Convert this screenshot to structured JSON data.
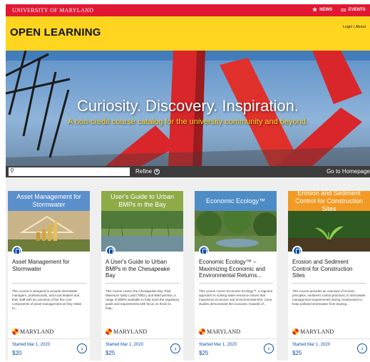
{
  "topbar": {
    "university": "UNIVERSITY OF MARYLAND",
    "news_label": "NEWS",
    "events_label": "EVENTS",
    "star_icon": "star-icon",
    "calendar_icon": "calendar-icon",
    "color": "#e21833"
  },
  "header": {
    "title": "OPEN LEARNING",
    "login": "Login",
    "separator": "|",
    "about": "About",
    "color": "#ffd520"
  },
  "hero": {
    "title": "Curiosity. Discovery. Inspiration.",
    "subtitle": "A non-credit course catalog for the university community and beyond."
  },
  "search": {
    "placeholder": "",
    "refine_label": "Refine",
    "homepage_label": "Go to Homepage"
  },
  "cards": [
    {
      "header": "Asset Management for Stormwater",
      "header_color": "#5b8fcb",
      "title": "Asset Management for Stormwater",
      "description": "This course is designed to provide stormwater managers, professionals, and local leaders and their staff with an overview of the five core components of asset management as they relate to...",
      "logo_text": "MARYLAND",
      "date": "Started Mar 1, 2020",
      "price": "$20"
    },
    {
      "header": "User's Guide to Urban BMPs in the Bay",
      "header_color": "#8dac48",
      "title": "A User's Guide to Urban BMPs in the Chesapeake Bay",
      "description": "This course covers the Chesapeake Bay Total Maximum Daily Load (TMDL) and BMd permits, a range of BMPs available to help meet the regulatory goals and requirements with focus on those to help...",
      "logo_text": "MARYLAND",
      "date": "Started Mar 1, 2020",
      "price": "$25"
    },
    {
      "header": "Economic Ecology™",
      "header_color": "#4d8cc4",
      "title": "Economic Ecology™ – Maximizing Economic and Environmental Returns...",
      "description": "This course covers Economic Ecology™, a regional approach to solving water-resource issues that maximizes economic and environmental ROI. Case studies demonstrate the economic rewards of...",
      "logo_text": "MARYLAND",
      "date": "Started Mar 1, 2020",
      "price": "$25"
    },
    {
      "header": "Erosion and Sediment Control for Construction Sites",
      "header_color": "#f29a24",
      "title": "Erosion and Sediment Control for Construction Sites",
      "description": "This course provides an overview of erosion principles, sediment control practices, E stormwater management requirements during construction to keep polluted stormwater from leaving...",
      "logo_text": "MARYLAND",
      "date": "Started Mar 1, 2020",
      "price": "$25"
    }
  ]
}
